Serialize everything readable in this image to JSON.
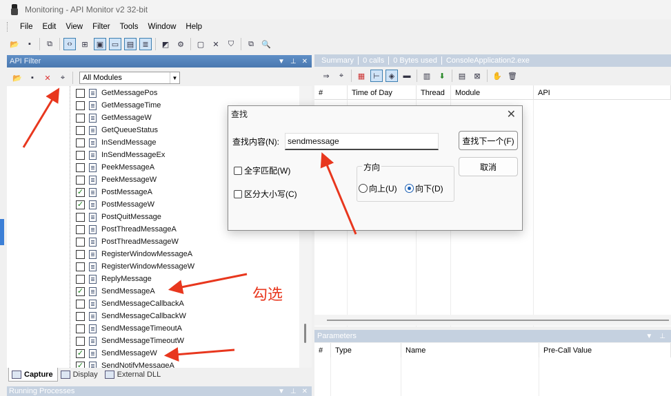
{
  "window": {
    "title": "Monitoring - API Monitor v2 32-bit"
  },
  "menu": [
    "File",
    "Edit",
    "View",
    "Filter",
    "Tools",
    "Window",
    "Help"
  ],
  "api_filter": {
    "title": "API Filter",
    "module_select": "All Modules",
    "items": [
      {
        "label": "GetMessagePos",
        "checked": false
      },
      {
        "label": "GetMessageTime",
        "checked": false
      },
      {
        "label": "GetMessageW",
        "checked": false
      },
      {
        "label": "GetQueueStatus",
        "checked": false
      },
      {
        "label": "InSendMessage",
        "checked": false
      },
      {
        "label": "InSendMessageEx",
        "checked": false
      },
      {
        "label": "PeekMessageA",
        "checked": false
      },
      {
        "label": "PeekMessageW",
        "checked": false
      },
      {
        "label": "PostMessageA",
        "checked": true
      },
      {
        "label": "PostMessageW",
        "checked": true
      },
      {
        "label": "PostQuitMessage",
        "checked": false
      },
      {
        "label": "PostThreadMessageA",
        "checked": false
      },
      {
        "label": "PostThreadMessageW",
        "checked": false
      },
      {
        "label": "RegisterWindowMessageA",
        "checked": false
      },
      {
        "label": "RegisterWindowMessageW",
        "checked": false
      },
      {
        "label": "ReplyMessage",
        "checked": false
      },
      {
        "label": "SendMessageA",
        "checked": true
      },
      {
        "label": "SendMessageCallbackA",
        "checked": false
      },
      {
        "label": "SendMessageCallbackW",
        "checked": false
      },
      {
        "label": "SendMessageTimeoutA",
        "checked": false
      },
      {
        "label": "SendMessageTimeoutW",
        "checked": false
      },
      {
        "label": "SendMessageW",
        "checked": true
      },
      {
        "label": "SendNotifyMessageA",
        "checked": true
      }
    ],
    "tabs": [
      "Capture",
      "Display",
      "External DLL"
    ]
  },
  "running_processes": {
    "title": "Running Processes"
  },
  "summary": {
    "title": "Summary",
    "calls": "0 calls",
    "bytes": "0 Bytes used",
    "process": "ConsoleApplication2.exe",
    "columns": [
      "#",
      "Time of Day",
      "Thread",
      "Module",
      "API"
    ]
  },
  "parameters": {
    "title": "Parameters",
    "columns": [
      "#",
      "Type",
      "Name",
      "Pre-Call Value"
    ]
  },
  "find_dialog": {
    "title": "查找",
    "find_label": "查找内容(N):",
    "find_value": "sendmessage",
    "find_next": "查找下一个(F)",
    "cancel": "取消",
    "whole_word": "全字匹配(W)",
    "match_case": "区分大小写(C)",
    "direction_title": "方向",
    "up": "向上(U)",
    "down": "向下(D)",
    "direction_selected": "down"
  },
  "annotation": {
    "text": "勾选",
    "color": "#e8371e"
  }
}
